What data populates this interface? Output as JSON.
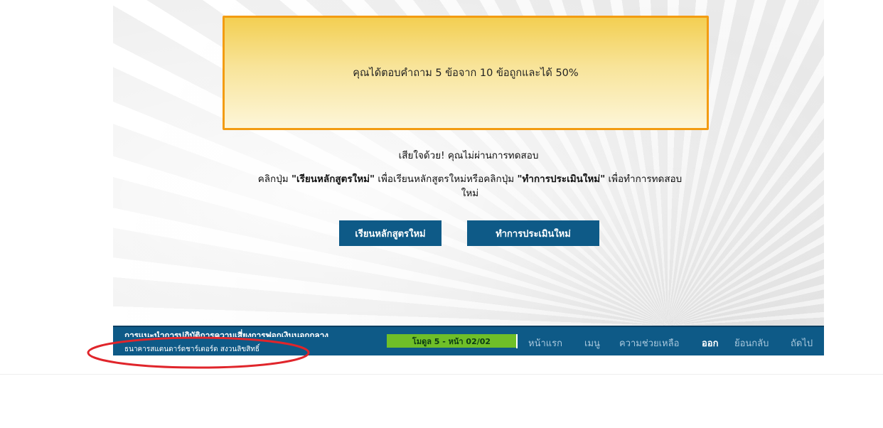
{
  "result": {
    "score_text": "คุณได้ตอบคำถาม 5 ข้อจาก 10 ข้อถูกและได้ 50%"
  },
  "message": {
    "fail": "เสียใจด้วย! คุณไม่ผ่านการทดสอบ",
    "instruction_prefix": "คลิกปุ่ม ",
    "instruction_bold_1": "\"เรียนหลักสูตรใหม่\"",
    "instruction_middle": " เพื่อเรียนหลักสูตรใหม่หรือคลิกปุ่ม ",
    "instruction_bold_2": "\"ทำการประเมินใหม่\"",
    "instruction_suffix": " เพื่อทำการทดสอบใหม่"
  },
  "buttons": {
    "restart_course": "เรียนหลักสูตรใหม่",
    "reassess": "ทำการประเมินใหม่"
  },
  "footer": {
    "course_title": "การแนะนำการปฏิบัติการความเสี่ยงการฟอกเงินนอกกลาง",
    "copyright": "ธนาคารสแตนดาร์ดชาร์เตอร์ด สงวนลิขสิทธิ์",
    "module_page": "โมดูล 5 - หน้า 02/02",
    "nav": {
      "home": "หน้าแรก",
      "menu": "เมนู",
      "help": "ความช่วยเหลือ",
      "exit": "ออก",
      "back": "ย้อนกลับ",
      "next": "ถัดไป"
    }
  },
  "colors": {
    "accent_blue": "#0e5a87",
    "score_border": "#f39c12",
    "module_pill": "#6fbf28",
    "annotation_red": "#e0252b"
  }
}
